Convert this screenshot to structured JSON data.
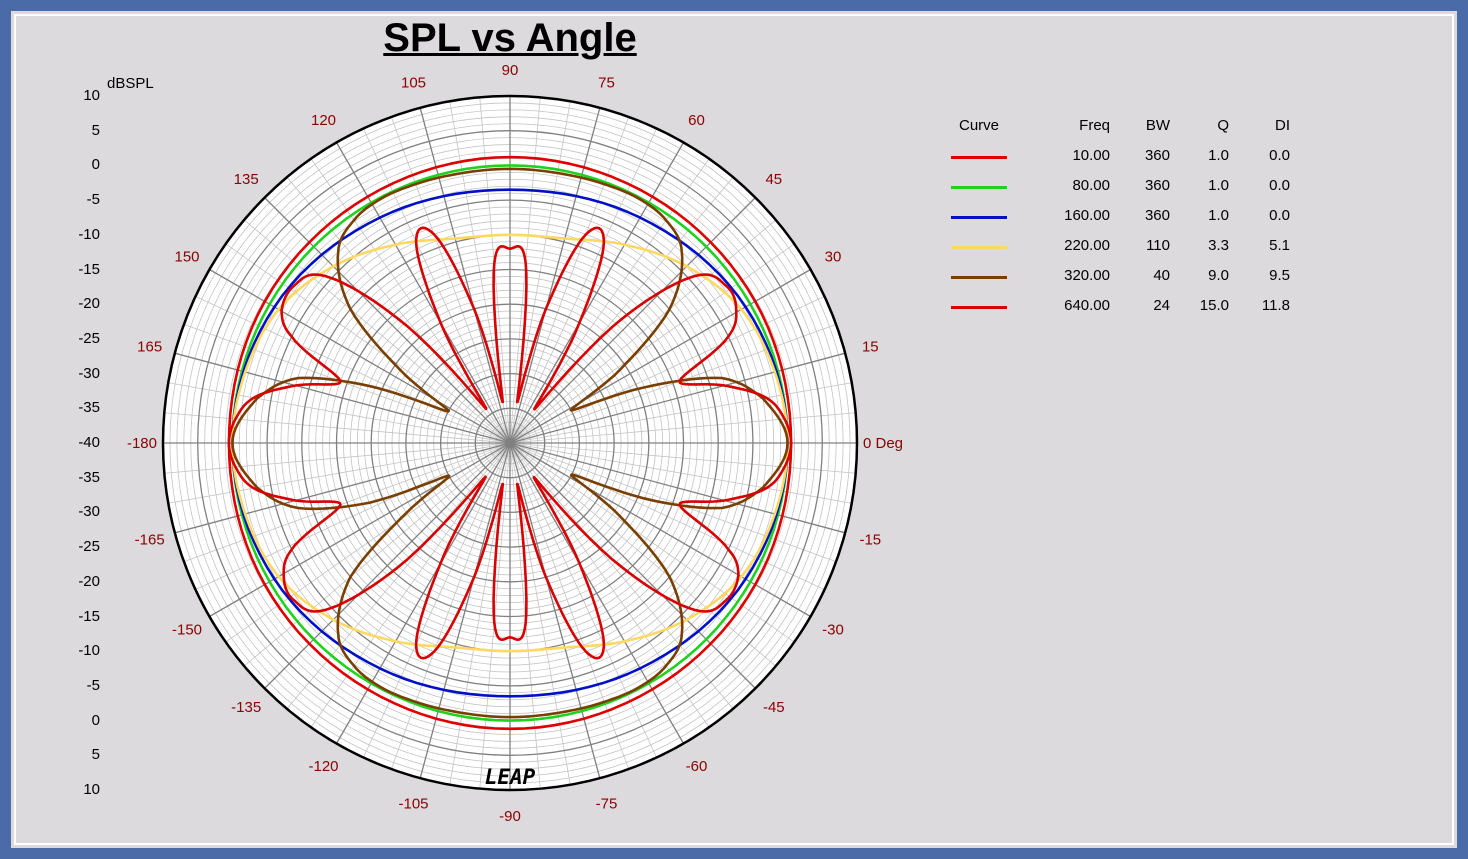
{
  "chart_data": {
    "type": "polar",
    "title": "SPL vs Angle",
    "radial_label": "dBSPL",
    "radial_ticks": [
      "10",
      "5",
      "0",
      "-5",
      "-10",
      "-15",
      "-20",
      "-25",
      "-30",
      "-35",
      "-40",
      "-35",
      "-30",
      "-25",
      "-20",
      "-15",
      "-10",
      "-5",
      "0",
      "5",
      "10"
    ],
    "rlim": [
      -40,
      10
    ],
    "angle_labels": [
      "0 Deg",
      "15",
      "30",
      "45",
      "60",
      "75",
      "90",
      "105",
      "120",
      "135",
      "150",
      "165",
      "-180",
      "-165",
      "-150",
      "-135",
      "-120",
      "-105",
      "-90",
      "-75",
      "-60",
      "-45",
      "-30",
      "-15"
    ],
    "angle_values": [
      0,
      15,
      30,
      45,
      60,
      75,
      90,
      105,
      120,
      135,
      150,
      165,
      180,
      -165,
      -150,
      -135,
      -120,
      -105,
      -90,
      -75,
      -60,
      -45,
      -30,
      -15
    ],
    "grid": true,
    "legend_position": "right",
    "legend_headers": {
      "curve": "Curve",
      "freq": "Freq",
      "bw": "BW",
      "q": "Q",
      "di": "DI"
    },
    "series": [
      {
        "color": "#e00000",
        "freq": "10.00",
        "bw": "360",
        "q": "1.0",
        "di": "0.0",
        "angles": [
          0,
          30,
          60,
          90,
          120,
          150,
          180,
          210,
          240,
          270,
          300,
          330
        ],
        "values": [
          0.5,
          0.8,
          1.0,
          1.2,
          1.0,
          0.8,
          0.5,
          0.8,
          1.0,
          1.2,
          1.0,
          0.8
        ]
      },
      {
        "color": "#1ed21e",
        "freq": "80.00",
        "bw": "360",
        "q": "1.0",
        "di": "0.0",
        "angles": [
          0,
          30,
          60,
          90,
          120,
          150,
          180,
          210,
          240,
          270,
          300,
          330
        ],
        "values": [
          0,
          0,
          0,
          0,
          0,
          0,
          0,
          0,
          0,
          0,
          0,
          0
        ]
      },
      {
        "color": "#0010c8",
        "freq": "160.00",
        "bw": "360",
        "q": "1.0",
        "di": "0.0",
        "angles": [
          0,
          30,
          60,
          90,
          120,
          150,
          180,
          210,
          240,
          270,
          300,
          330
        ],
        "values": [
          0,
          -0.8,
          -2.5,
          -3.5,
          -2.5,
          -0.8,
          0,
          -0.8,
          -2.5,
          -3.5,
          -2.5,
          -0.8
        ]
      },
      {
        "color": "#ffd860",
        "freq": "220.00",
        "bw": "110",
        "q": "3.3",
        "di": "5.1",
        "angles": [
          0,
          15,
          30,
          45,
          60,
          75,
          90,
          105,
          120,
          135,
          150,
          165,
          180,
          195,
          210,
          225,
          240,
          255,
          270,
          285,
          300,
          315,
          330,
          345
        ],
        "values": [
          0,
          -0.5,
          -1.5,
          -4,
          -7,
          -9.5,
          -10,
          -9.5,
          -7,
          -4,
          -1.5,
          -0.5,
          0,
          -0.5,
          -1.5,
          -4,
          -7,
          -9.5,
          -10,
          -9.5,
          -7,
          -4,
          -1.5,
          -0.5
        ]
      },
      {
        "color": "#7a3f00",
        "freq": "320.00",
        "bw": "40",
        "q": "9.0",
        "di": "9.5",
        "angles": [
          0,
          10,
          17,
          22,
          28,
          33,
          40,
          48,
          55,
          62,
          70,
          80,
          90,
          100,
          110,
          118,
          125,
          132,
          140,
          147,
          153,
          158,
          163,
          170,
          180,
          190,
          197,
          203,
          208,
          214,
          220,
          228,
          235,
          242,
          250,
          260,
          270,
          280,
          290,
          298,
          305,
          312,
          320,
          327,
          333,
          338,
          343,
          350
        ],
        "values": [
          0,
          -3,
          -8,
          -18,
          -30,
          -22,
          -10,
          -3,
          -0.8,
          -0.2,
          -0.3,
          -0.5,
          -0.5,
          -0.5,
          -0.3,
          -0.2,
          -0.8,
          -3,
          -10,
          -22,
          -30,
          -18,
          -8,
          -3,
          0,
          -3,
          -8,
          -18,
          -30,
          -22,
          -10,
          -3,
          -0.8,
          -0.2,
          -0.3,
          -0.5,
          -0.5,
          -0.5,
          -0.3,
          -0.2,
          -0.8,
          -3,
          -10,
          -22,
          -30,
          -18,
          -8,
          -3
        ]
      },
      {
        "color": "#d80000",
        "freq": "640.00",
        "bw": "24",
        "q": "15.0",
        "di": "11.8",
        "angles": [
          0,
          5,
          10,
          15,
          20,
          26,
          31,
          36,
          42,
          48,
          54,
          60,
          65,
          70,
          75,
          80,
          85,
          90,
          95,
          100,
          105,
          110,
          115,
          120,
          125,
          132,
          138,
          144,
          150,
          154,
          160,
          165,
          170,
          175,
          180,
          185,
          190,
          195,
          200,
          206,
          211,
          216,
          222,
          228,
          234,
          240,
          245,
          250,
          255,
          260,
          265,
          270,
          275,
          280,
          285,
          290,
          295,
          300,
          305,
          312,
          318,
          324,
          330,
          334,
          340,
          345,
          350,
          355
        ],
        "values": [
          0.5,
          -0.3,
          -2.5,
          -8,
          -14,
          -5,
          -2,
          -1.5,
          -4,
          -16,
          -34,
          -20,
          -8,
          -8,
          -20,
          -34,
          -14,
          -12,
          -14,
          -34,
          -20,
          -8,
          -8,
          -20,
          -34,
          -16,
          -4,
          -1.5,
          -2,
          -5,
          -14,
          -8,
          -2.5,
          -0.3,
          0.5,
          -0.3,
          -2.5,
          -8,
          -14,
          -5,
          -2,
          -1.5,
          -4,
          -16,
          -34,
          -20,
          -8,
          -8,
          -20,
          -34,
          -14,
          -12,
          -14,
          -34,
          -20,
          -8,
          -8,
          -20,
          -34,
          -16,
          -4,
          -1.5,
          -2,
          -5,
          -14,
          -8,
          -2.5,
          -0.3
        ]
      }
    ]
  },
  "logo_text": "LEAP"
}
